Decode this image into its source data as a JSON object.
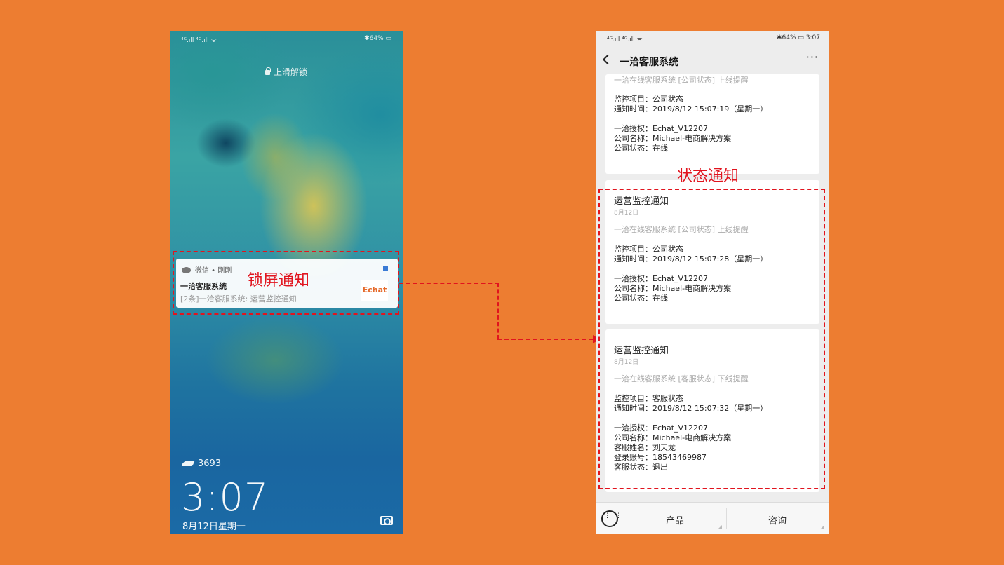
{
  "lock_screen": {
    "status_left": "⁴ᴳ.ıll ⁴ᴳ.ıll ᯤ",
    "status_right": "✱64% ▭",
    "unlock_hint": "上滑解锁",
    "notification": {
      "app": "微信 • 刚刚",
      "title": "一洽客服系统",
      "body": "[2条]一洽客服系统: 运营监控通知",
      "logo_text": "Echat"
    },
    "steps": "3693",
    "time": "3:07",
    "date": "8月12日星期一"
  },
  "annotations": {
    "lock_label": "锁屏通知",
    "status_label": "状态通知",
    "color": "#E1141E"
  },
  "chat": {
    "status_left": "⁴ᴳ.ıll ⁴ᴳ.ıll ᯤ",
    "status_right": "✱64% ▭ 3:07",
    "title": "一洽客服系统",
    "more": "···",
    "card0": {
      "subtitle": "一洽在线客服系统 [公司状态] 上线提醒",
      "lines": [
        "监控项目：公司状态",
        "通知时间：2019/8/12 15:07:19（星期一）",
        "一洽授权：Echat_V12207",
        "公司名称：Michael-电商解决方案",
        "公司状态：在线"
      ]
    },
    "card1": {
      "title": "运营监控通知",
      "date": "8月12日",
      "subtitle": "一洽在线客服系统 [公司状态] 上线提醒",
      "lines": [
        "监控项目：公司状态",
        "通知时间：2019/8/12 15:07:28（星期一）",
        "一洽授权：Echat_V12207",
        "公司名称：Michael-电商解决方案",
        "公司状态：在线"
      ]
    },
    "card2": {
      "title": "运营监控通知",
      "date": "8月12日",
      "subtitle": "一洽在线客服系统 [客服状态] 下线提醒",
      "lines": [
        "监控项目：客服状态",
        "通知时间：2019/8/12 15:07:32（星期一）",
        "一洽授权：Echat_V12207",
        "公司名称：Michael-电商解决方案",
        "客服姓名：刘天龙",
        "登录账号：18543469987",
        "客服状态：退出"
      ]
    },
    "footer": {
      "menu1": "产品",
      "menu2": "咨询"
    }
  }
}
